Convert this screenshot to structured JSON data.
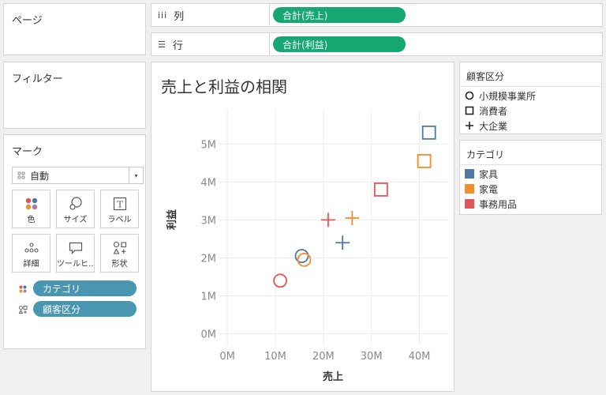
{
  "panels": {
    "pages_title": "ページ",
    "filters_title": "フィルター",
    "marks_title": "マーク"
  },
  "marks": {
    "type_label": "自動",
    "buttons": [
      {
        "label": "色",
        "icon": "color-icon"
      },
      {
        "label": "サイズ",
        "icon": "size-icon"
      },
      {
        "label": "ラベル",
        "icon": "label-icon"
      },
      {
        "label": "詳細",
        "icon": "detail-icon"
      },
      {
        "label": "ツールヒ…",
        "icon": "tooltip-icon"
      },
      {
        "label": "形状",
        "icon": "shape-icon"
      }
    ],
    "pills": [
      {
        "label": "カテゴリ",
        "icon": "color-icon"
      },
      {
        "label": "顧客区分",
        "icon": "shape-icon"
      }
    ]
  },
  "shelves": {
    "columns_label": "列",
    "columns_pill": "合計(売上)",
    "rows_label": "行",
    "rows_pill": "合計(利益)"
  },
  "legend_segment": {
    "title": "顧客区分",
    "items": [
      {
        "label": "小規模事業所",
        "shape": "circle"
      },
      {
        "label": "消費者",
        "shape": "square"
      },
      {
        "label": "大企業",
        "shape": "plus"
      }
    ]
  },
  "legend_category": {
    "title": "カテゴリ",
    "items": [
      {
        "label": "家具",
        "color": "#4e79a7"
      },
      {
        "label": "家電",
        "color": "#f28e2b"
      },
      {
        "label": "事務用品",
        "color": "#e15759"
      }
    ]
  },
  "chart_data": {
    "type": "scatter",
    "title": "売上と利益の相関",
    "xlabel": "売上",
    "ylabel": "利益",
    "xlim": [
      -2,
      46
    ],
    "ylim": [
      -0.3,
      5.9
    ],
    "x_ticks": [
      0,
      10,
      20,
      30,
      40
    ],
    "x_tick_labels": [
      "0M",
      "10M",
      "20M",
      "30M",
      "40M"
    ],
    "y_ticks": [
      0,
      1,
      2,
      3,
      4,
      5
    ],
    "y_tick_labels": [
      "0M",
      "1M",
      "2M",
      "3M",
      "4M",
      "5M"
    ],
    "grid": true,
    "points": [
      {
        "category": "家具",
        "segment": "小規模事業所",
        "x": 15.5,
        "y": 2.05
      },
      {
        "category": "家電",
        "segment": "小規模事業所",
        "x": 16.0,
        "y": 1.95
      },
      {
        "category": "事務用品",
        "segment": "小規模事業所",
        "x": 11.0,
        "y": 1.4
      },
      {
        "category": "家具",
        "segment": "消費者",
        "x": 42.0,
        "y": 5.3
      },
      {
        "category": "家電",
        "segment": "消費者",
        "x": 41.0,
        "y": 4.55
      },
      {
        "category": "事務用品",
        "segment": "消費者",
        "x": 32.0,
        "y": 3.8
      },
      {
        "category": "家具",
        "segment": "大企業",
        "x": 24.0,
        "y": 2.4
      },
      {
        "category": "家電",
        "segment": "大企業",
        "x": 26.0,
        "y": 3.05
      },
      {
        "category": "事務用品",
        "segment": "大企業",
        "x": 21.0,
        "y": 3.0
      }
    ],
    "colors": {
      "家具": "#4e79a7",
      "家電": "#f28e2b",
      "事務用品": "#e15759"
    },
    "shapes": {
      "小規模事業所": "circle",
      "消費者": "square",
      "大企業": "plus"
    }
  }
}
